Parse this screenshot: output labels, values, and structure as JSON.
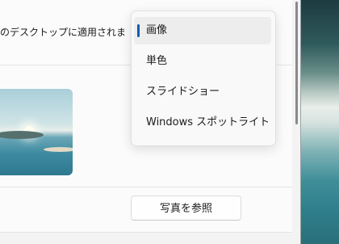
{
  "description_text": "のデスクトップに適用されま",
  "dropdown": {
    "options": [
      {
        "label": "画像",
        "selected": true
      },
      {
        "label": "単色",
        "selected": false
      },
      {
        "label": "スライドショー",
        "selected": false
      },
      {
        "label": "Windows スポットライト",
        "selected": false
      }
    ]
  },
  "browse_button_label": "写真を参照",
  "colors": {
    "accent": "#005fb8",
    "card_background": "#fbfbfb",
    "page_background": "#f3f3f3"
  }
}
